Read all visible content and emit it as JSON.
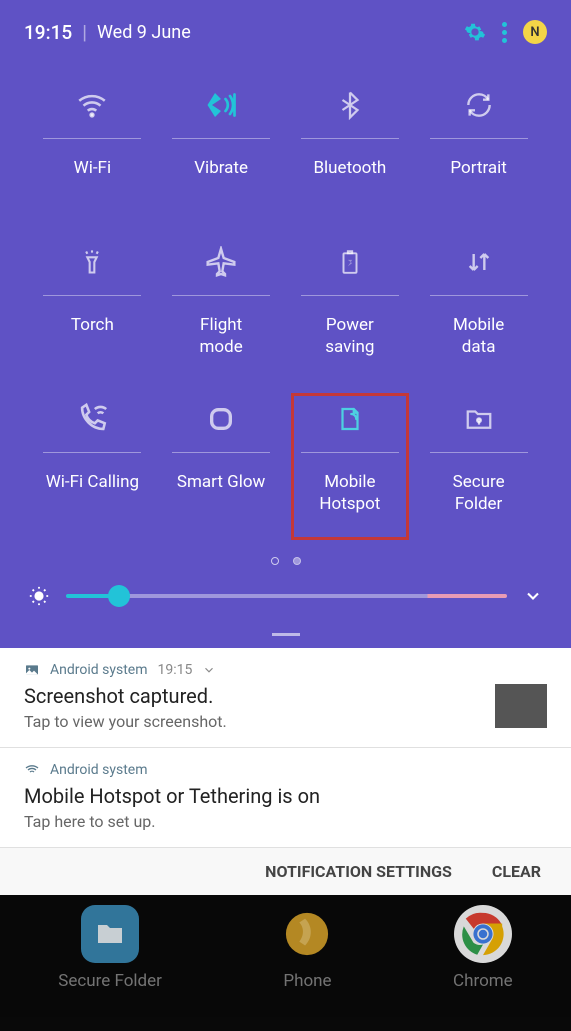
{
  "status": {
    "time": "19:15",
    "date": "Wed 9 June",
    "avatar_letter": "N"
  },
  "tiles": [
    {
      "label": "Wi-Fi",
      "icon": "wifi",
      "active": false
    },
    {
      "label": "Vibrate",
      "icon": "vibrate",
      "active": true
    },
    {
      "label": "Bluetooth",
      "icon": "bluetooth",
      "active": false
    },
    {
      "label": "Portrait",
      "icon": "rotate",
      "active": false
    },
    {
      "label": "Torch",
      "icon": "torch",
      "active": false
    },
    {
      "label": "Flight\nmode",
      "icon": "airplane",
      "active": false
    },
    {
      "label": "Power\nsaving",
      "icon": "battery",
      "active": false
    },
    {
      "label": "Mobile\ndata",
      "icon": "arrows",
      "active": false
    },
    {
      "label": "Wi-Fi Calling",
      "icon": "wificall",
      "active": false
    },
    {
      "label": "Smart Glow",
      "icon": "glow",
      "active": false
    },
    {
      "label": "Mobile\nHotspot",
      "icon": "hotspot",
      "active": true,
      "highlighted": true
    },
    {
      "label": "Secure\nFolder",
      "icon": "folder",
      "active": false
    }
  ],
  "brightness_pct": 12,
  "notifications": [
    {
      "app": "Android system",
      "time": "19:15",
      "title": "Screenshot captured.",
      "subtitle": "Tap to view your screenshot.",
      "has_thumb": true,
      "has_chevron": true
    },
    {
      "app": "Android system",
      "title": "Mobile Hotspot or Tethering is on",
      "subtitle": "Tap here to set up."
    }
  ],
  "actions": {
    "settings": "NOTIFICATION SETTINGS",
    "clear": "CLEAR"
  },
  "home_apps": [
    {
      "label": "Secure Folder"
    },
    {
      "label": "Phone"
    },
    {
      "label": "Chrome"
    }
  ]
}
